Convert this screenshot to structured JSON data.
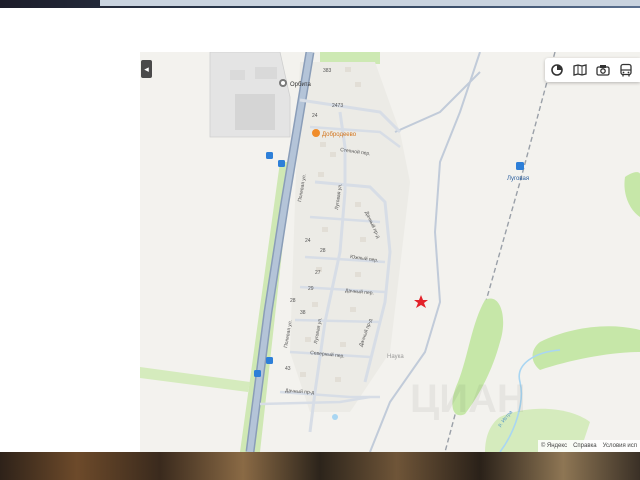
{
  "map": {
    "places": {
      "orbita": "Орбита",
      "dobrodeevo": "Добродеево",
      "lugovaya": "Луговая",
      "nauka": "Наука"
    },
    "streets": {
      "polevaya_top": "Полевая ул.",
      "polevaya_bottom": "Полевая ул.",
      "lugovaya_ul_top": "Луговая ул.",
      "lugovaya_ul_bottom": "Луговая ул.",
      "stepnoy": "Степной пер.",
      "dachny_pr_top": "Дачный пр-д",
      "yuzhny": "Южный пер.",
      "dachny_per": "Дачный пер.",
      "dachny_pr_mid": "Дачный пр-д",
      "severny": "Северный пер.",
      "dachny_pr_bottom": "Дачный пр-д",
      "river": "р. Истра"
    },
    "house_numbers": [
      "383",
      "24",
      "2473",
      "24",
      "28",
      "27",
      "28",
      "38",
      "29",
      "43"
    ],
    "watermark": "ЦИАН",
    "colors": {
      "road": "#a8b8cf",
      "green": "#c6e7a8",
      "water": "#a9d6f2",
      "pin": "#e3222a"
    }
  },
  "controls": {
    "collapse_icon": "chevron-left-icon",
    "buttons": [
      "circle-icon",
      "map-layers-icon",
      "camera-icon",
      "bus-icon"
    ]
  },
  "copyright": {
    "yandex": "© Яндекс",
    "help": "Справка",
    "terms": "Условия исп"
  }
}
